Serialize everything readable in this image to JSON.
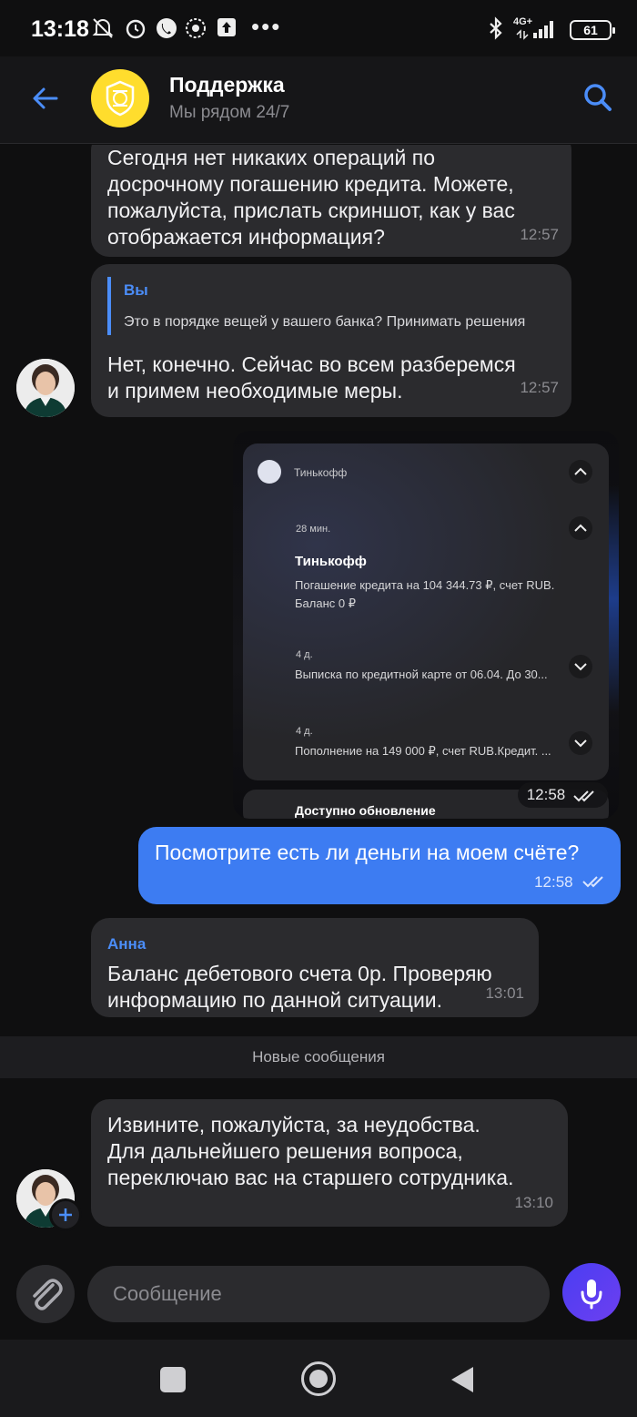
{
  "status_bar": {
    "time": "13:18",
    "dots": "•••",
    "network": "4G+",
    "battery": "61"
  },
  "header": {
    "title": "Поддержка",
    "subtitle": "Мы рядом 24/7"
  },
  "messages": {
    "m1": {
      "text_lines": [
        "Сегодня нет никаких операций по",
        "досрочному погашению кредита. Можете,",
        "пожалуйста, прислать скриншот, как у вас",
        "отображается информация?"
      ],
      "time": "12:57"
    },
    "m2": {
      "reply_name": "Вы",
      "reply_text": "Это в порядке вещей у вашего банка? Принимать решения",
      "text_lines": [
        "Нет, конечно. Сейчас во всем разберемся",
        "и примем необходимые меры."
      ],
      "time": "12:57"
    },
    "m3_image": {
      "app_name": "Тинькофф",
      "notif_time": "28 мин.",
      "notif_title": "Тинькофф",
      "notif_text1": "Погашение кредита на 104 344.73 ₽, счет RUB.",
      "notif_text2": "Баланс 0 ₽",
      "n2_age": "4 д.",
      "n2_text": "Выписка по кредитной карте от 06.04. До 30...",
      "n3_age": "4 д.",
      "n3_text": "Пополнение на 149 000 ₽, счет RUB.Кредит. ...",
      "bottom_text": "Доступно обновление",
      "time": "12:58"
    },
    "m4": {
      "text": "Посмотрите есть ли деньги на моем счёте?",
      "time": "12:58"
    },
    "m5": {
      "sender": "Анна",
      "text_lines": [
        "Баланс дебетового счета 0р. Проверяю",
        "информацию по данной ситуации."
      ],
      "time": "13:01"
    },
    "divider": "Новые сообщения",
    "m6": {
      "text_lines": [
        "Извините, пожалуйста, за неудобства.",
        "Для дальнейшего решения вопроса,",
        "переключаю вас на старшего сотрудника."
      ],
      "time": "13:10"
    }
  },
  "input": {
    "placeholder": "Сообщение"
  },
  "colors": {
    "accent": "#3d7cf2",
    "link": "#4b8df8",
    "bubble": "#2b2b2e",
    "background": "#0f0f10",
    "logo_yellow": "#ffdd2d"
  },
  "icons": [
    "back-arrow-icon",
    "search-icon",
    "attach-icon",
    "mic-icon",
    "double-check-icon",
    "chevron-up-icon",
    "chevron-down-icon"
  ]
}
